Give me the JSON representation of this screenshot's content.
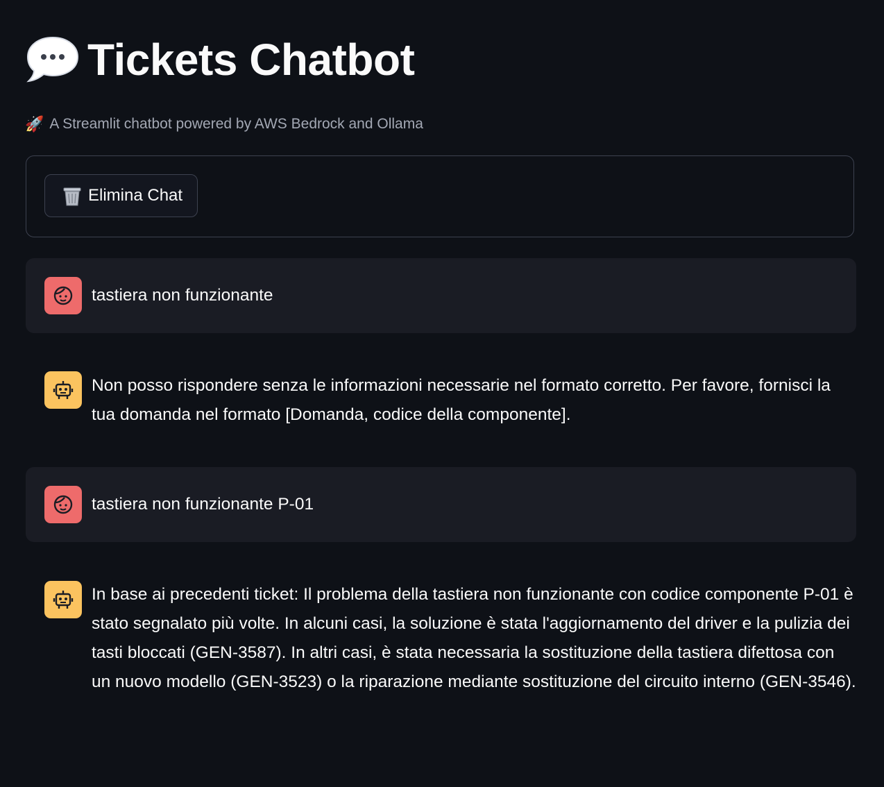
{
  "header": {
    "title": "Tickets Chatbot",
    "title_icon": "speech-bubble-icon",
    "subtitle_icon": "rocket-icon",
    "subtitle": "A Streamlit chatbot powered by AWS Bedrock and Ollama"
  },
  "toolbar": {
    "clear_icon": "trash-icon",
    "clear_label": "Elimina Chat"
  },
  "messages": [
    {
      "role": "user",
      "avatar": "user-face-icon",
      "text": "tastiera non funzionante"
    },
    {
      "role": "assistant",
      "avatar": "robot-icon",
      "text": "Non posso rispondere senza le informazioni necessarie nel formato corretto. Per favore, fornisci la tua domanda nel formato [Domanda, codice della componente]."
    },
    {
      "role": "user",
      "avatar": "user-face-icon",
      "text": "tastiera non funzionante P-01"
    },
    {
      "role": "assistant",
      "avatar": "robot-icon",
      "text": "In base ai precedenti ticket: Il problema della tastiera non funzionante con codice componente P-01 è stato segnalato più volte. In alcuni casi, la soluzione è stata l'aggiornamento del driver e la pulizia dei tasti bloccati (GEN-3587). In altri casi, è stata necessaria la sostituzione della tastiera difettosa con un nuovo modello (GEN-3523) o la riparazione mediante sostituzione del circuito interno (GEN-3546)."
    }
  ],
  "colors": {
    "background": "#0e1117",
    "user_message_bg": "#1a1c24",
    "user_avatar": "#ee6b6b",
    "assistant_avatar": "#fbc35f",
    "border": "#3d4250",
    "muted_text": "#a3a8b4"
  }
}
